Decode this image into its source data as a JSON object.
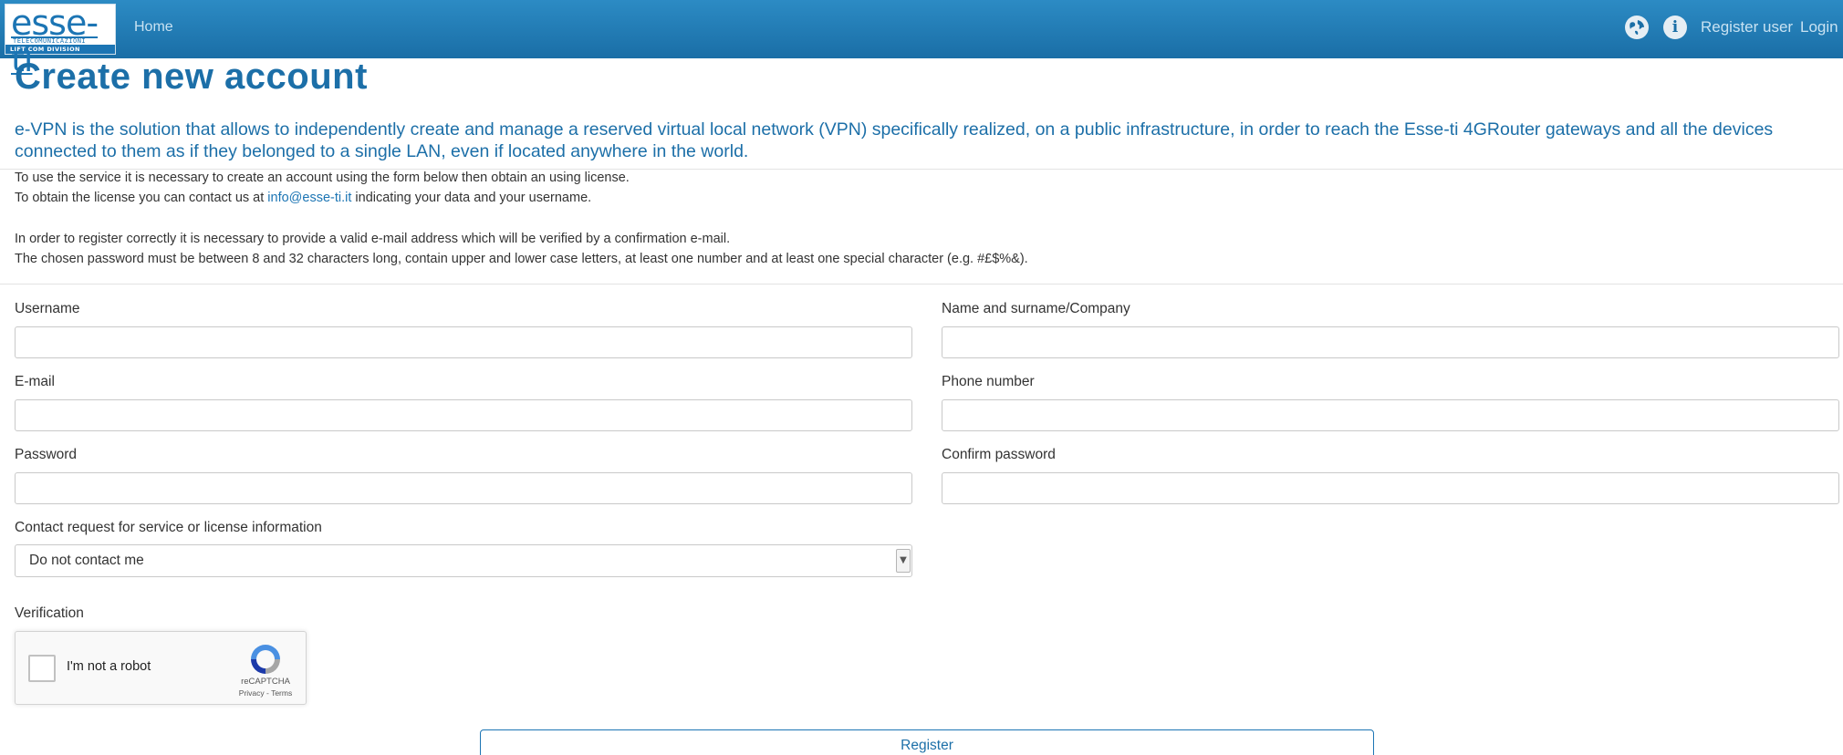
{
  "navbar": {
    "logo_text": "esse-ti",
    "logo_subtitle": "TELECOMUNICAZIONI",
    "logo_band": "LIFT COM DIVISION",
    "home_label": "Home",
    "globe_icon": "globe-icon",
    "info_icon": "info-icon",
    "register_label": "Register user",
    "login_label": "Login"
  },
  "page": {
    "title": "Create new account",
    "intro": "e-VPN is the solution that allows to independently create and manage a reserved virtual local network (VPN) specifically realized, on a public infrastructure, in order to reach the Esse-ti 4GRouter gateways and all the devices connected to them as if they belonged to a single LAN, even if located anywhere in the world.",
    "help_line1": "To use the service it is necessary to create an account using the form below then obtain an using license.",
    "help_line2_before": "To obtain the license you can contact us at ",
    "help_line2_link": "info@esse-ti.it",
    "help_line2_after": " indicating your data and your username.",
    "help_line3": "In order to register correctly it is necessary to provide a valid e-mail address which will be verified by a confirmation e-mail.",
    "help_line4": "The chosen password must be between 8 and 32 characters long, contain upper and lower case letters, at least one number and at least one special character (e.g. #£$%&)."
  },
  "form": {
    "username_label": "Username",
    "username_value": "",
    "name_label": "Name and surname/Company",
    "name_value": "",
    "email_label": "E-mail",
    "email_value": "",
    "phone_label": "Phone number",
    "phone_value": "",
    "password_label": "Password",
    "password_value": "",
    "confirm_password_label": "Confirm password",
    "confirm_password_value": "",
    "contact_label": "Contact request for service or license information",
    "contact_selected": "Do not contact me",
    "verification_label": "Verification",
    "captcha_label": "I'm not a robot",
    "captcha_brand": "reCAPTCHA",
    "captcha_links": "Privacy - Terms",
    "register_button": "Register"
  },
  "colors": {
    "navbar": "#1f78b1",
    "accent": "#1c6fa8",
    "link": "#1c75b4"
  }
}
